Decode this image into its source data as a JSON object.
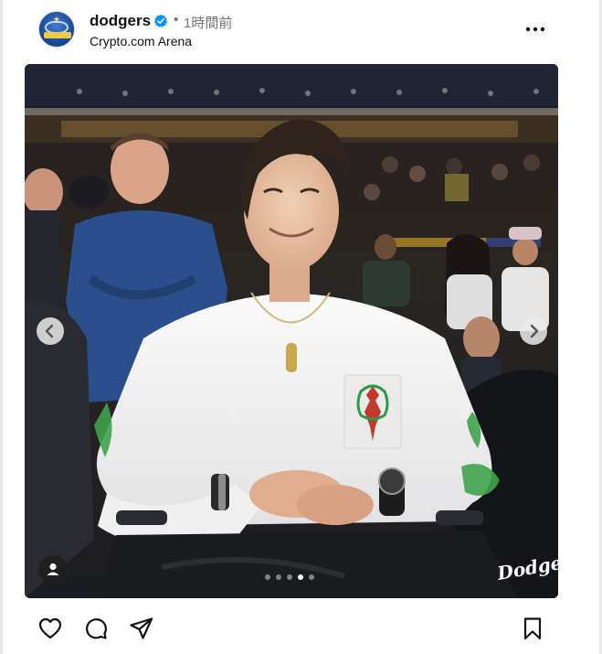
{
  "post": {
    "username": "dodgers",
    "separator": "•",
    "timestamp": "1時間前",
    "location": "Crypto.com Arena",
    "verified": true,
    "avatar": {
      "icon": "champions-logo-icon",
      "text": "CHAMPIONS"
    }
  },
  "media": {
    "carousel": {
      "total": 5,
      "current": 4
    },
    "watermark": "Dodgers",
    "colors": {
      "arena_gold": "#f0b429",
      "shirt": "#f4f4f4",
      "dodger_blue": "#2b4f8c"
    }
  },
  "actions": {
    "like_icon": "heart-icon",
    "comment_icon": "comment-icon",
    "share_icon": "share-icon",
    "save_icon": "bookmark-icon"
  }
}
